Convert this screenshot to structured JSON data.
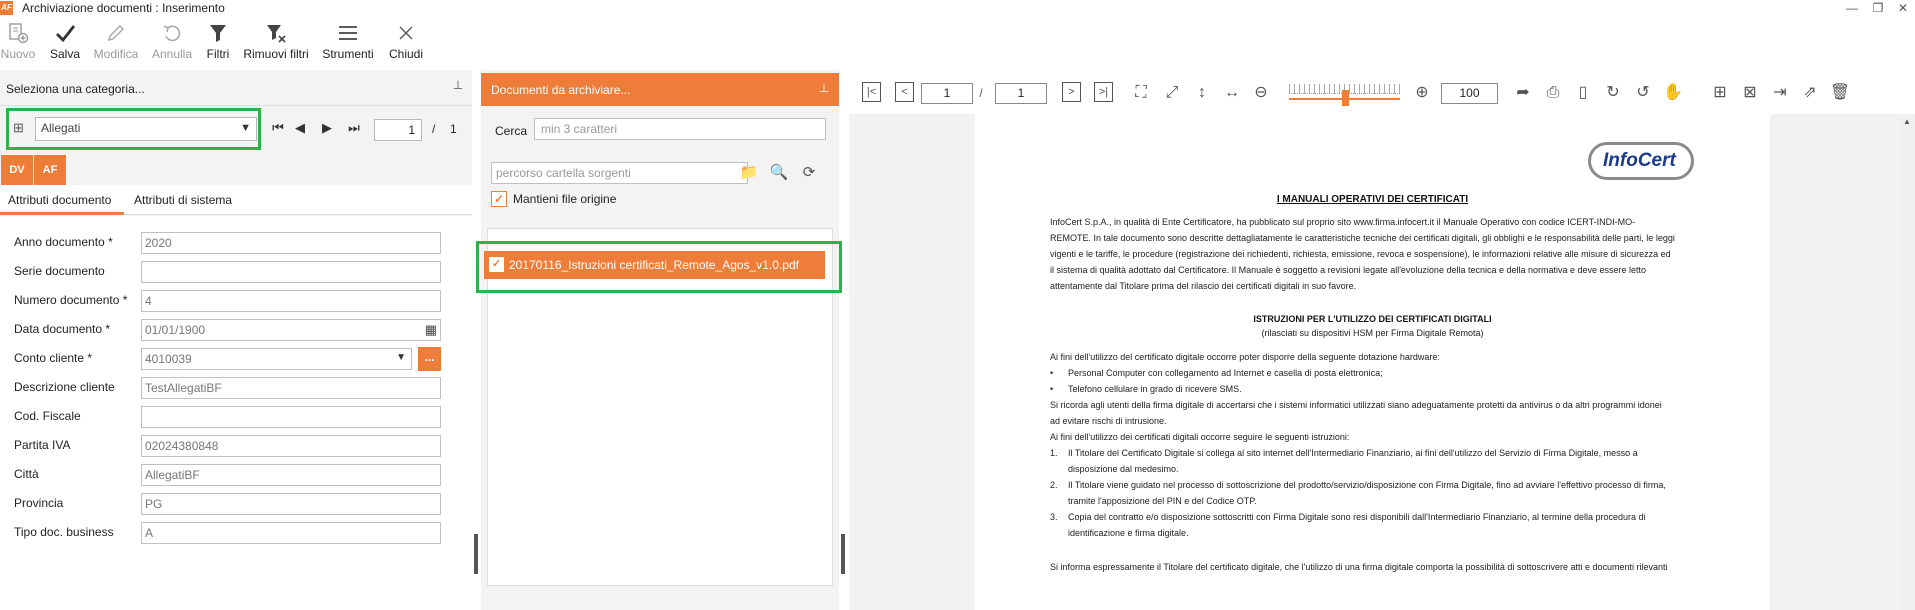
{
  "window": {
    "logo": "AF",
    "title": "Archiviazione documenti : Inserimento",
    "minimize": "—",
    "maximize": "❐",
    "close": "✕"
  },
  "toolbar": {
    "nuovo": "Nuovo",
    "salva": "Salva",
    "modifica": "Modifica",
    "annulla": "Annulla",
    "filtri": "Filtri",
    "rimuovi_filtri": "Rimuovi filtri",
    "strumenti": "Strumenti",
    "chiudi": "Chiudi"
  },
  "left_panel": {
    "title": "Seleziona una categoria...",
    "category": "Allegati",
    "page_current": "1",
    "page_sep": "/",
    "page_total": "1",
    "tab_dv": "DV",
    "tab_af": "AF",
    "tab_attr_doc": "Attributi documento",
    "tab_attr_sys": "Attributi di sistema",
    "fields": [
      {
        "label": "Anno documento *",
        "value": "2020"
      },
      {
        "label": "Serie documento",
        "value": ""
      },
      {
        "label": "Numero documento *",
        "value": "4"
      },
      {
        "label": "Data documento *",
        "value": "01/01/1900"
      },
      {
        "label": "Conto cliente *",
        "value": "4010039"
      },
      {
        "label": "Descrizione cliente",
        "value": "TestAllegatiBF"
      },
      {
        "label": "Cod. Fiscale",
        "value": ""
      },
      {
        "label": "Partita IVA",
        "value": "02024380848"
      },
      {
        "label": "Città",
        "value": "AllegatiBF"
      },
      {
        "label": "Provincia",
        "value": "PG"
      },
      {
        "label": "Tipo doc. business",
        "value": "A"
      }
    ],
    "ellipsis": "..."
  },
  "middle_panel": {
    "title": "Documenti da archiviare...",
    "cerca_label": "Cerca",
    "cerca_placeholder": "min 3 caratteri",
    "path_placeholder": "percorso cartella sorgenti",
    "keep_label": "Mantieni file origine",
    "file_name": "20170116_Istruzioni certificati_Remote_Agos_v1.0.pdf"
  },
  "viewer": {
    "page_current": "1",
    "page_sep": "/",
    "page_total": "1",
    "zoom": "100",
    "logo_text": "InfoCert",
    "heading1": "I MANUALI OPERATIVI DEI CERTIFICATI",
    "para1": [
      "InfoCert S.p.A., in qualità di Ente Certificatore, ha pubblicato sul proprio sito www.firma.infocert.it il Manuale Operativo con codice ICERT-INDI-MO-",
      "REMOTE. In tale documento sono descritte dettagliatamente le caratteristiche tecniche dei certificati digitali, gli obblighi e le responsabilità delle parti, le leggi",
      "vigenti e le tariffe, le procedure (registrazione dei richiedenti, richiesta, emissione, revoca e sospensione), le informazioni relative alle misure di sicurezza ed",
      "il sistema di qualità adottato dal Certificatore. Il Manuale è soggetto a revisioni legate all'evoluzione della tecnica e della normativa e deve essere letto",
      "attentamente dal Titolare prima del rilascio dei certificati digitali in suo favore."
    ],
    "heading2": "ISTRUZIONI PER L'UTILIZZO DEI CERTIFICATI DIGITALI",
    "subheading2": "(rilasciati su dispositivi HSM per Firma Digitale Remota)",
    "intro": "Ai fini dell'utilizzo del certificato digitale occorre poter disporre della seguente dotazione hardware:",
    "bullets": [
      "Personal Computer con collegamento ad Internet e casella di posta elettronica;",
      "Telefono cellulare in grado di ricevere SMS."
    ],
    "bullet_mark": "•",
    "para2": [
      "Si ricorda agli utenti della firma digitale di accertarsi che i sistemi informatici utilizzati siano adeguatamente protetti da antivirus o da altri programmi idonei",
      "ad evitare rischi di intrusione.",
      "Ai fini dell'utilizzo dei certificati digitali occorre seguire le seguenti istruzioni:"
    ],
    "steps": [
      {
        "n": "1.",
        "lines": [
          "Il Titolare del Certificato Digitale si collega al sito internet dell'Intermediario Finanziario, ai fini dell'utilizzo del Servizio di Firma Digitale, messo a",
          "disposizione dal medesimo."
        ]
      },
      {
        "n": "2.",
        "lines": [
          "Il Titolare viene guidato nel processo di sottoscrizione del prodotto/servizio/disposizione con Firma Digitale, fino ad avviare l'effettivo processo di firma,",
          "tramite l'apposizione del PIN e del Codice OTP."
        ]
      },
      {
        "n": "3.",
        "lines": [
          "Copia del contratto e/o disposizione sottoscritti con Firma Digitale sono resi disponibili dall'Intermediario Finanziario, al termine della procedura di",
          "identificazione e firma digitale."
        ]
      }
    ],
    "last_line": "Si informa espressamente il Titolare del certificato digitale, che l'utilizzo di una firma digitale comporta la possibilità di sottoscrivere atti e documenti rilevanti"
  },
  "colors": {
    "accent": "#ef7d3a",
    "highlight": "#2db14a"
  }
}
